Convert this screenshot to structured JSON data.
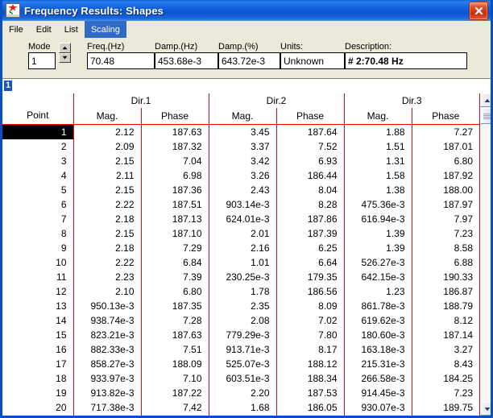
{
  "window": {
    "title": "Frequency Results: Shapes",
    "app_icon": "shapes-app-icon",
    "close_label": "✕",
    "accent_title_color": "#0b54cf",
    "grid_line_color": "#ff0000"
  },
  "menu": {
    "items": [
      {
        "label": "File",
        "active": false
      },
      {
        "label": "Edit",
        "active": false
      },
      {
        "label": "List",
        "active": false
      },
      {
        "label": "Scaling",
        "active": true
      }
    ]
  },
  "parameters": {
    "mode_label": "Mode",
    "mode_value": "1",
    "spinner_up": "spinner-up-arrow",
    "spinner_down": "spinner-down-arrow",
    "fields": [
      {
        "label": "Freq.(Hz)",
        "value": "70.48"
      },
      {
        "label": "Damp.(Hz)",
        "value": "453.68e-3"
      },
      {
        "label": "Damp.(%)",
        "value": "643.72e-3"
      },
      {
        "label": "Units:",
        "value": "Unknown"
      },
      {
        "label": "Description:",
        "value": "# 2:70.48 Hz"
      }
    ]
  },
  "row_indicator": {
    "value": "1"
  },
  "table": {
    "point_header": "Point",
    "groups": [
      {
        "name": "Dir.1",
        "columns": [
          "Mag.",
          "Phase"
        ]
      },
      {
        "name": "Dir.2",
        "columns": [
          "Mag.",
          "Phase"
        ]
      },
      {
        "name": "Dir.3",
        "columns": [
          "Mag.",
          "Phase"
        ]
      }
    ],
    "selected_row": 1,
    "rows": [
      {
        "point": "1",
        "cells": [
          "2.12",
          "187.63",
          "3.45",
          "187.64",
          "1.88",
          "7.27"
        ]
      },
      {
        "point": "2",
        "cells": [
          "2.09",
          "187.32",
          "3.37",
          "7.52",
          "1.51",
          "187.01"
        ]
      },
      {
        "point": "3",
        "cells": [
          "2.15",
          "7.04",
          "3.42",
          "6.93",
          "1.31",
          "6.80"
        ]
      },
      {
        "point": "4",
        "cells": [
          "2.11",
          "6.98",
          "3.26",
          "186.44",
          "1.58",
          "187.92"
        ]
      },
      {
        "point": "5",
        "cells": [
          "2.15",
          "187.36",
          "2.43",
          "8.04",
          "1.38",
          "188.00"
        ]
      },
      {
        "point": "6",
        "cells": [
          "2.22",
          "187.51",
          "903.14e-3",
          "8.28",
          "475.36e-3",
          "187.97"
        ]
      },
      {
        "point": "7",
        "cells": [
          "2.18",
          "187.13",
          "624.01e-3",
          "187.86",
          "616.94e-3",
          "7.97"
        ]
      },
      {
        "point": "8",
        "cells": [
          "2.15",
          "187.10",
          "2.01",
          "187.39",
          "1.39",
          "7.23"
        ]
      },
      {
        "point": "9",
        "cells": [
          "2.18",
          "7.29",
          "2.16",
          "6.25",
          "1.39",
          "8.58"
        ]
      },
      {
        "point": "10",
        "cells": [
          "2.22",
          "6.84",
          "1.01",
          "6.64",
          "526.27e-3",
          "6.88"
        ]
      },
      {
        "point": "11",
        "cells": [
          "2.23",
          "7.39",
          "230.25e-3",
          "179.35",
          "642.15e-3",
          "190.33"
        ]
      },
      {
        "point": "12",
        "cells": [
          "2.10",
          "6.80",
          "1.78",
          "186.56",
          "1.23",
          "186.87"
        ]
      },
      {
        "point": "13",
        "cells": [
          "950.13e-3",
          "187.35",
          "2.35",
          "8.09",
          "861.78e-3",
          "188.79"
        ]
      },
      {
        "point": "14",
        "cells": [
          "938.74e-3",
          "7.28",
          "2.08",
          "7.02",
          "619.62e-3",
          "8.12"
        ]
      },
      {
        "point": "15",
        "cells": [
          "823.21e-3",
          "187.63",
          "779.29e-3",
          "7.80",
          "180.60e-3",
          "187.14"
        ]
      },
      {
        "point": "16",
        "cells": [
          "882.33e-3",
          "7.51",
          "913.71e-3",
          "8.17",
          "163.18e-3",
          "3.27"
        ]
      },
      {
        "point": "17",
        "cells": [
          "858.27e-3",
          "188.09",
          "525.07e-3",
          "188.12",
          "215.31e-3",
          "8.43"
        ]
      },
      {
        "point": "18",
        "cells": [
          "933.97e-3",
          "7.10",
          "603.51e-3",
          "188.34",
          "266.58e-3",
          "184.25"
        ]
      },
      {
        "point": "19",
        "cells": [
          "913.82e-3",
          "187.22",
          "2.20",
          "187.53",
          "914.45e-3",
          "7.23"
        ]
      },
      {
        "point": "20",
        "cells": [
          "717.38e-3",
          "7.42",
          "1.68",
          "186.05",
          "930.07e-3",
          "189.75"
        ]
      }
    ]
  },
  "scrollbar": {
    "up_icon": "scroll-up-arrow",
    "down_icon": "scroll-down-arrow",
    "thumb": "scroll-thumb"
  }
}
